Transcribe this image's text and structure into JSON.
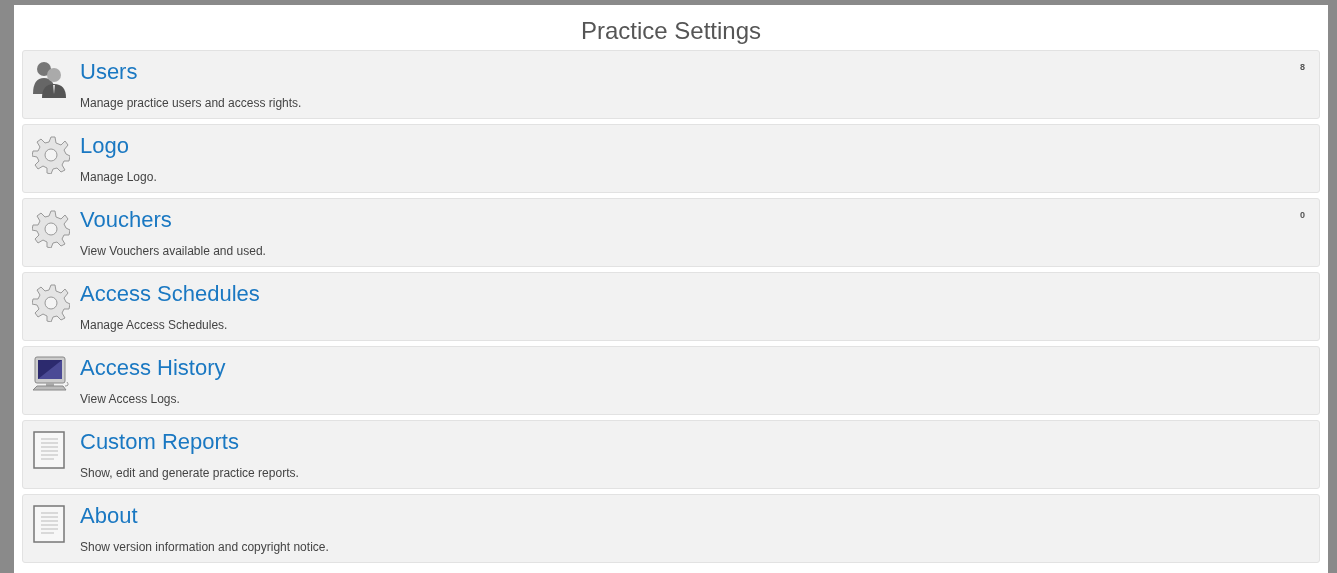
{
  "title": "Practice Settings",
  "items": [
    {
      "kind": "users",
      "label": "Users",
      "description": "Manage practice users and access rights.",
      "count": "8"
    },
    {
      "kind": "gear",
      "label": "Logo",
      "description": "Manage Logo."
    },
    {
      "kind": "gear",
      "label": "Vouchers",
      "description": "View Vouchers available and used.",
      "count": "0"
    },
    {
      "kind": "gear",
      "label": "Access Schedules",
      "description": "Manage Access Schedules."
    },
    {
      "kind": "computer",
      "label": "Access History",
      "description": "View Access Logs."
    },
    {
      "kind": "document",
      "label": "Custom Reports",
      "description": "Show, edit and generate practice reports."
    },
    {
      "kind": "document",
      "label": "About",
      "description": "Show version information and copyright notice."
    }
  ]
}
